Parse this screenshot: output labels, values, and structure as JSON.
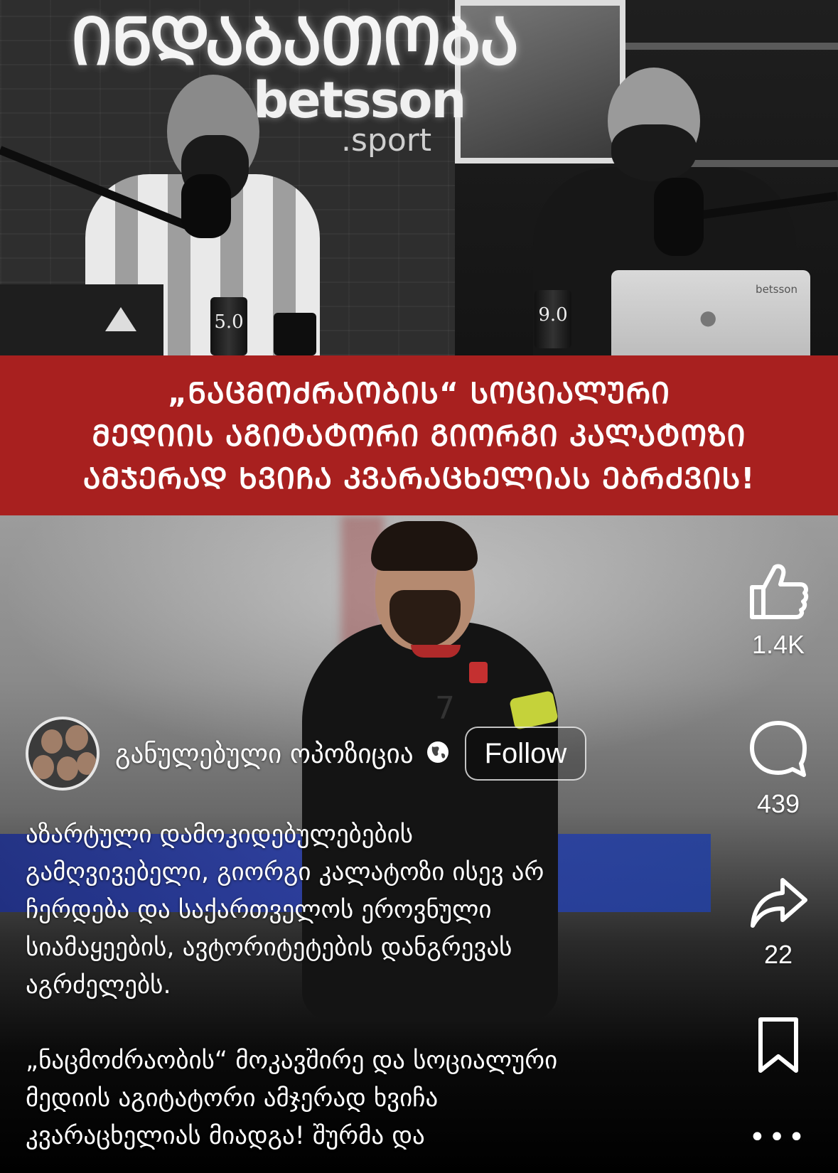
{
  "image": {
    "top_sign_text": "ᲘᲜᲓᲐᲑᲐᲗᲝᲑᲐ",
    "top_brand": "betsson",
    "top_brand_sub": ".sport",
    "can_left_label": "5.0",
    "can_right_label": "9.0",
    "laptop_label": "betsson",
    "shirt_number": "7",
    "banner_lines": [
      "„ᲜᲐᲪᲛᲝᲫᲠᲐᲝᲑᲘᲡ“ ᲡᲝᲪᲘᲐᲚᲣᲠᲘ",
      "ᲛᲔᲓᲘᲘᲡ ᲐᲒᲘᲢᲐᲢᲝᲠᲘ ᲒᲘᲝᲠᲒᲘ ᲙᲐᲚᲐᲢᲝᲖᲘ",
      "ᲐᲛᲯᲔᲠᲐᲓ ᲮᲕᲘᲩᲐ ᲙᲕᲐᲠᲐᲪᲮᲔᲚᲘᲐᲡ ᲔᲑᲠᲫᲕᲘᲡ!"
    ]
  },
  "actions": {
    "like": {
      "icon": "thumbs-up-icon",
      "count": "1.4K"
    },
    "comment": {
      "icon": "comment-icon",
      "count": "439"
    },
    "share": {
      "icon": "share-icon",
      "count": "22"
    },
    "save": {
      "icon": "bookmark-icon"
    },
    "more": {
      "icon": "more-icon",
      "label": "•••"
    }
  },
  "author": {
    "name": "განულებული ოპოზიცია",
    "visibility_icon": "globe-icon",
    "follow_label": "Follow"
  },
  "caption": {
    "lines_1": [
      "აზარტული დამოკიდებულებების",
      "გამღვივებელი, გიორგი კალატოზი ისევ არ",
      "ჩერდება და საქართველოს ეროვნული",
      "სიამაყეების, ავტორიტეტების დანგრევას",
      "აგრძელებს."
    ],
    "lines_2": [
      "„ნაცმოძრაობის“ მოკავშირე და სოციალური",
      "მედიის აგიტატორი ამჯერად ხვიჩა",
      "კვარაცხელიას მიადგა! შურმა და"
    ]
  },
  "colors": {
    "banner_red": "#a8201f",
    "text": "#ffffff",
    "background": "#000000"
  }
}
